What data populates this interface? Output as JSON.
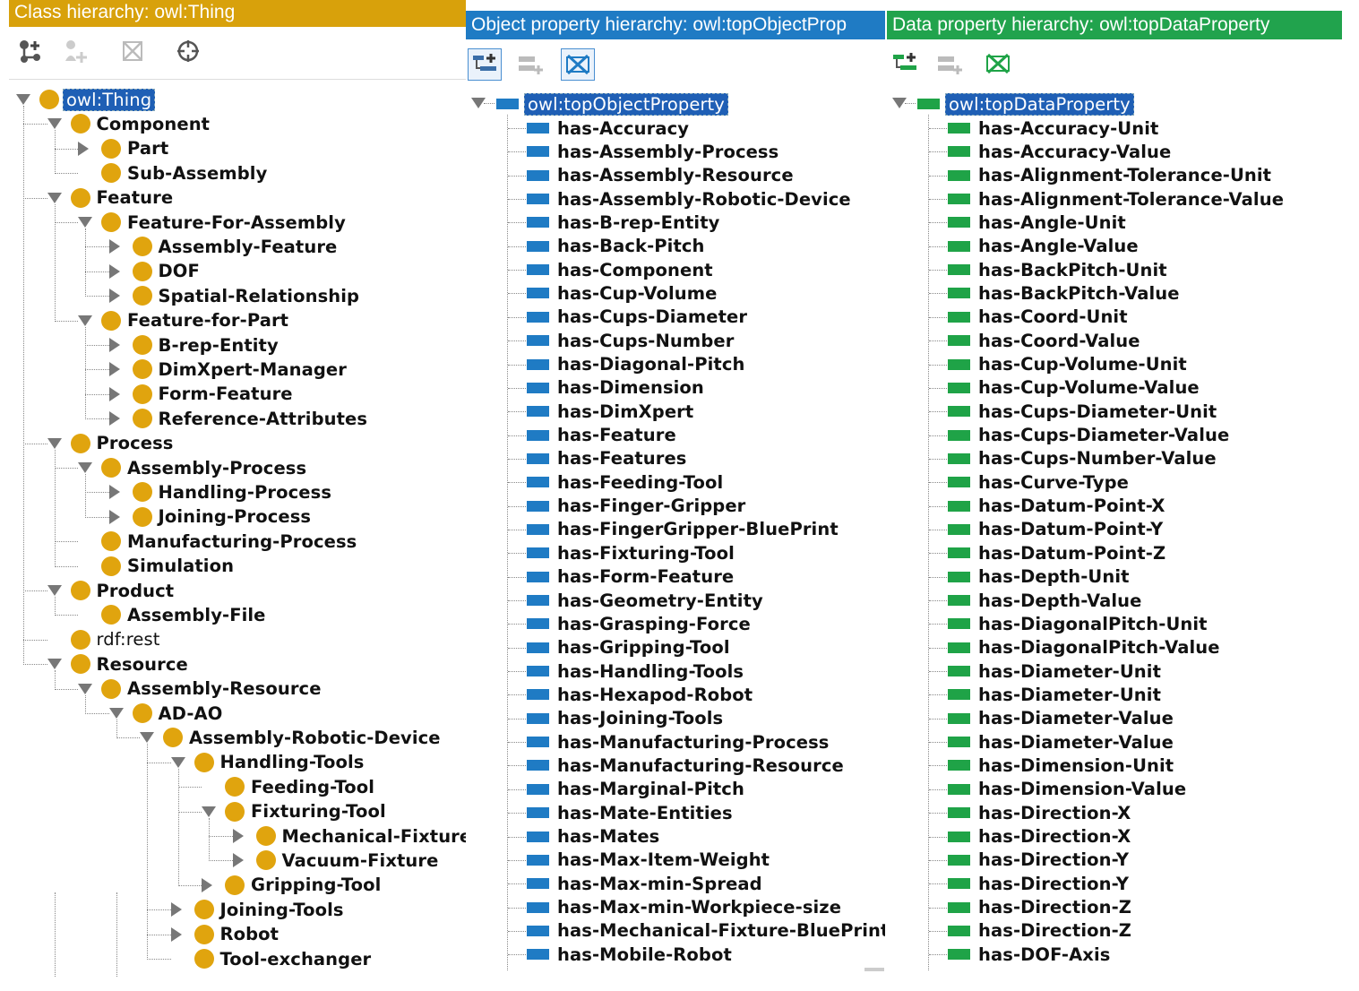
{
  "class_panel": {
    "title": "Class hierarchy: owl:Thing",
    "toolbar": [
      "add-subclass-icon",
      "add-sibling-icon",
      "delete-class-icon",
      "target-icon"
    ],
    "rows": [
      {
        "label": "owl:Thing",
        "depth": 0,
        "tw": "open",
        "style": "root"
      },
      {
        "label": "Component",
        "depth": 1,
        "tw": "open"
      },
      {
        "label": "Part",
        "depth": 2,
        "tw": "closed"
      },
      {
        "label": "Sub-Assembly",
        "depth": 2,
        "tw": "none"
      },
      {
        "label": "Feature",
        "depth": 1,
        "tw": "open"
      },
      {
        "label": "Feature-For-Assembly",
        "depth": 2,
        "tw": "open"
      },
      {
        "label": "Assembly-Feature",
        "depth": 3,
        "tw": "closed"
      },
      {
        "label": "DOF",
        "depth": 3,
        "tw": "closed"
      },
      {
        "label": "Spatial-Relationship",
        "depth": 3,
        "tw": "closed"
      },
      {
        "label": "Feature-for-Part",
        "depth": 2,
        "tw": "open"
      },
      {
        "label": "B-rep-Entity",
        "depth": 3,
        "tw": "closed"
      },
      {
        "label": "DimXpert-Manager",
        "depth": 3,
        "tw": "closed"
      },
      {
        "label": "Form-Feature",
        "depth": 3,
        "tw": "closed"
      },
      {
        "label": "Reference-Attributes",
        "depth": 3,
        "tw": "closed"
      },
      {
        "label": "Process",
        "depth": 1,
        "tw": "open"
      },
      {
        "label": "Assembly-Process",
        "depth": 2,
        "tw": "open"
      },
      {
        "label": "Handling-Process",
        "depth": 3,
        "tw": "closed"
      },
      {
        "label": "Joining-Process",
        "depth": 3,
        "tw": "closed"
      },
      {
        "label": "Manufacturing-Process",
        "depth": 2,
        "tw": "none"
      },
      {
        "label": "Simulation",
        "depth": 2,
        "tw": "none"
      },
      {
        "label": "Product",
        "depth": 1,
        "tw": "open"
      },
      {
        "label": "Assembly-File",
        "depth": 2,
        "tw": "none"
      },
      {
        "label": "rdf:rest",
        "depth": 1,
        "tw": "none",
        "style": "plain"
      },
      {
        "label": "Resource",
        "depth": 1,
        "tw": "open"
      },
      {
        "label": "Assembly-Resource",
        "depth": 2,
        "tw": "open"
      },
      {
        "label": "AD-AO",
        "depth": 3,
        "tw": "open"
      },
      {
        "label": "Assembly-Robotic-Device",
        "depth": 4,
        "tw": "open"
      },
      {
        "label": "Handling-Tools",
        "depth": 5,
        "tw": "open"
      },
      {
        "label": "Feeding-Tool",
        "depth": 6,
        "tw": "none"
      },
      {
        "label": "Fixturing-Tool",
        "depth": 6,
        "tw": "open"
      },
      {
        "label": "Mechanical-Fixture",
        "depth": 7,
        "tw": "closed"
      },
      {
        "label": "Vacuum-Fixture",
        "depth": 7,
        "tw": "closed"
      },
      {
        "label": "Gripping-Tool",
        "depth": 6,
        "tw": "closed"
      },
      {
        "label": "Joining-Tools",
        "depth": 5,
        "tw": "closed"
      },
      {
        "label": "Robot",
        "depth": 5,
        "tw": "closed"
      },
      {
        "label": "Tool-exchanger",
        "depth": 5,
        "tw": "none"
      }
    ]
  },
  "object_panel": {
    "title": "Object property hierarchy: owl:topObjectProp",
    "toolbar": [
      "add-subproperty-icon",
      "add-sibling-property-icon",
      "delete-property-icon"
    ],
    "root": "owl:topObjectProperty",
    "items": [
      "has-Accuracy",
      "has-Assembly-Process",
      "has-Assembly-Resource",
      "has-Assembly-Robotic-Device",
      "has-B-rep-Entity",
      "has-Back-Pitch",
      "has-Component",
      "has-Cup-Volume",
      "has-Cups-Diameter",
      "has-Cups-Number",
      "has-Diagonal-Pitch",
      "has-Dimension",
      "has-DimXpert",
      "has-Feature",
      "has-Features",
      "has-Feeding-Tool",
      "has-Finger-Gripper",
      "has-FingerGripper-BluePrint",
      "has-Fixturing-Tool",
      "has-Form-Feature",
      "has-Geometry-Entity",
      "has-Grasping-Force",
      "has-Gripping-Tool",
      "has-Handling-Tools",
      "has-Hexapod-Robot",
      "has-Joining-Tools",
      "has-Manufacturing-Process",
      "has-Manufacturing-Resource",
      "has-Marginal-Pitch",
      "has-Mate-Entities",
      "has-Mates",
      "has-Max-Item-Weight",
      "has-Max-min-Spread",
      "has-Max-min-Workpiece-size",
      "has-Mechanical-Fixture-BluePrint",
      "has-Mobile-Robot"
    ]
  },
  "data_panel": {
    "title": "Data property hierarchy: owl:topDataProperty",
    "toolbar": [
      "add-subproperty-icon",
      "add-sibling-property-icon",
      "delete-property-icon"
    ],
    "root": "owl:topDataProperty",
    "items": [
      "has-Accuracy-Unit",
      "has-Accuracy-Value",
      "has-Alignment-Tolerance-Unit",
      "has-Alignment-Tolerance-Value",
      "has-Angle-Unit",
      "has-Angle-Value",
      "has-BackPitch-Unit",
      "has-BackPitch-Value",
      "has-Coord-Unit",
      "has-Coord-Value",
      "has-Cup-Volume-Unit",
      "has-Cup-Volume-Value",
      "has-Cups-Diameter-Unit",
      "has-Cups-Diameter-Value",
      "has-Cups-Number-Value",
      "has-Curve-Type",
      "has-Datum-Point-X",
      "has-Datum-Point-Y",
      "has-Datum-Point-Z",
      "has-Depth-Unit",
      "has-Depth-Value",
      "has-DiagonalPitch-Unit",
      "has-DiagonalPitch-Value",
      "has-Diameter-Unit",
      "has-Diameter-Unit",
      "has-Diameter-Value",
      "has-Diameter-Value",
      "has-Dimension-Unit",
      "has-Dimension-Value",
      "has-Direction-X",
      "has-Direction-X",
      "has-Direction-Y",
      "has-Direction-Y",
      "has-Direction-Z",
      "has-Direction-Z",
      "has-DOF-Axis"
    ]
  },
  "colors": {
    "class_accent": "#d8a10b",
    "object_accent": "#1f7bc4",
    "data_accent": "#21a34d",
    "selection": "#1f5fb5"
  }
}
